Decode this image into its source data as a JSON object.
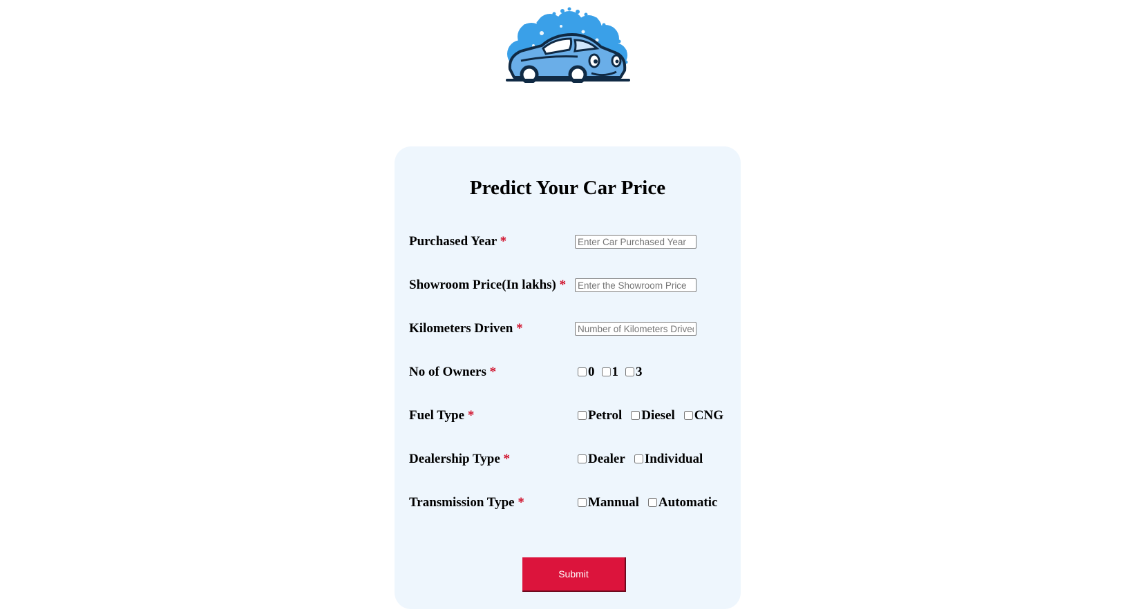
{
  "logo": {
    "icon": "car-wash-logo-icon",
    "colors": {
      "bubbles": "#3aa0e8",
      "body": "#6aaee8",
      "outline": "#102a44"
    }
  },
  "form": {
    "title": "Predict Your Car Price",
    "required_mark": "*",
    "fields": {
      "year": {
        "label": "Purchased Year",
        "placeholder": "Enter Car Purchased Year",
        "value": ""
      },
      "price": {
        "label": "Showroom Price(In lakhs)",
        "placeholder": "Enter the Showroom Price",
        "value": ""
      },
      "kms": {
        "label": "Kilometers Driven",
        "placeholder": "Number of Kilometers Drived",
        "value": ""
      }
    },
    "owners": {
      "label": "No of Owners",
      "options": [
        {
          "label": "0",
          "checked": false
        },
        {
          "label": "1",
          "checked": false
        },
        {
          "label": "3",
          "checked": false
        }
      ]
    },
    "fuel": {
      "label": "Fuel Type",
      "options": [
        {
          "label": "Petrol",
          "checked": false
        },
        {
          "label": "Diesel",
          "checked": false
        },
        {
          "label": "CNG",
          "checked": false
        }
      ]
    },
    "dealer": {
      "label": "Dealership Type",
      "options": [
        {
          "label": "Dealer",
          "checked": false
        },
        {
          "label": "Individual",
          "checked": false
        }
      ]
    },
    "transmission": {
      "label": "Transmission Type",
      "options": [
        {
          "label": "Mannual",
          "checked": false
        },
        {
          "label": "Automatic",
          "checked": false
        }
      ]
    },
    "submit_label": "Submit",
    "colors": {
      "card_bg": "#eef6fd",
      "required": "#d0102a",
      "submit_bg": "#dc143c"
    }
  }
}
